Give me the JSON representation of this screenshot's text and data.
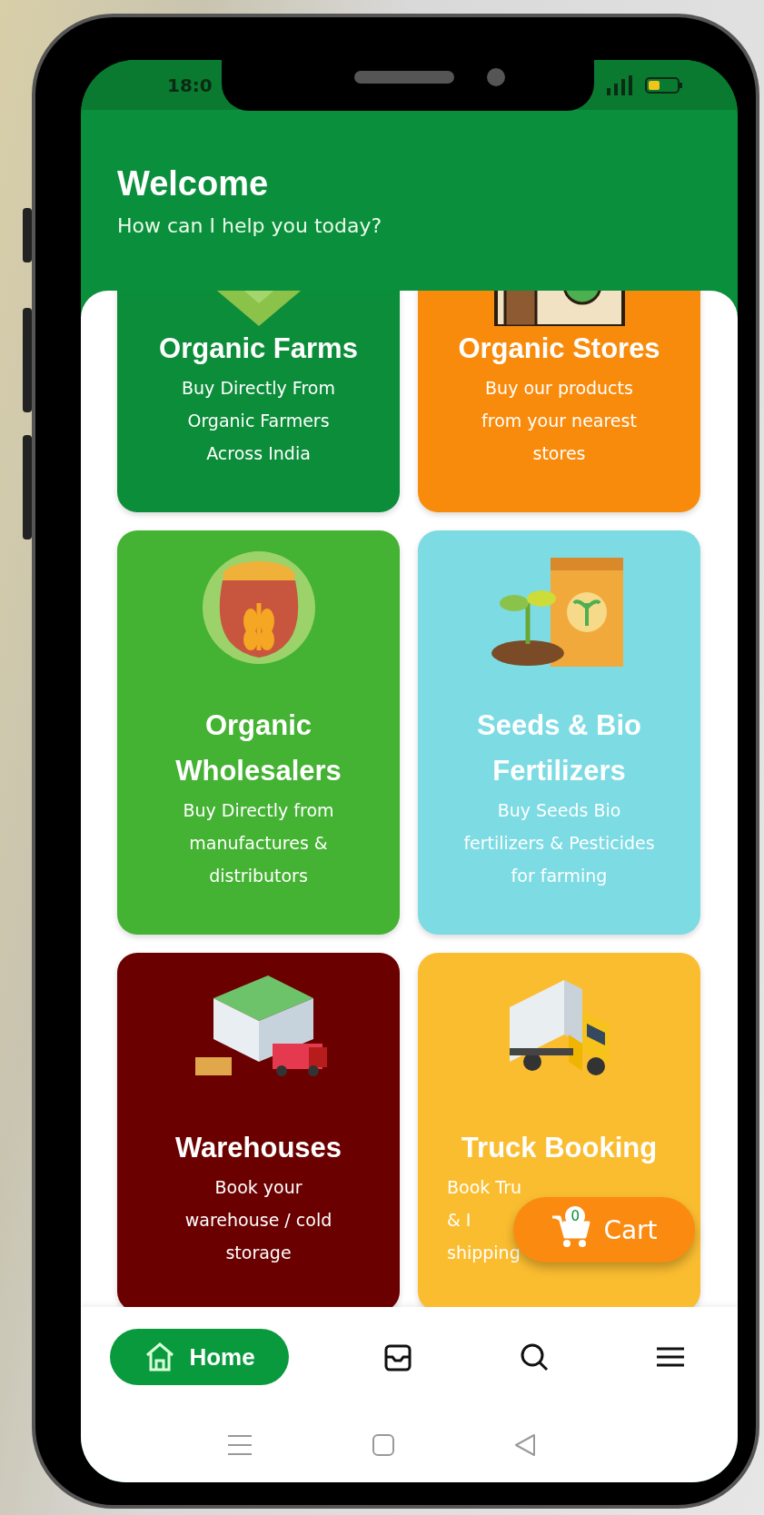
{
  "status_bar": {
    "time": "18:0"
  },
  "header": {
    "title": "Welcome",
    "subtitle": "How can I help you today?"
  },
  "cards": [
    {
      "kind": "farm",
      "color": "#0c8d3a",
      "title": "Organic Farms",
      "description_lines": [
        "Buy Directly From",
        "Organic Farmers",
        "Across India"
      ],
      "partly_covered": false
    },
    {
      "kind": "store",
      "color": "#f98b0c",
      "title": "Organic Stores",
      "description_lines": [
        "Buy our products",
        "from your nearest",
        "stores"
      ],
      "partly_covered": false
    },
    {
      "kind": "pot",
      "color": "#44b232",
      "title": "Organic Wholesalers",
      "description_lines": [
        "Buy Directly from",
        "manufactures &",
        "distributors"
      ],
      "partly_covered": false
    },
    {
      "kind": "seeds",
      "color": "#7cdbe3",
      "title": "Seeds & Bio Fertilizers",
      "description_lines": [
        "Buy Seeds Bio",
        "fertilizers & Pesticides",
        "for farming"
      ],
      "partly_covered": false
    },
    {
      "kind": "warehouse",
      "color": "#6b0000",
      "title": "Warehouses",
      "description_lines": [
        "Book your",
        "warehouse / cold",
        "storage"
      ],
      "partly_covered": false
    },
    {
      "kind": "truck",
      "color": "#fbbd30",
      "title": "Truck Booking",
      "description_lines": [
        "Book Tru",
        "& I",
        "shipping"
      ],
      "partly_covered": true
    }
  ],
  "cart_button": {
    "label": "Cart",
    "count": "0"
  },
  "bottom_nav": [
    {
      "kind": "home",
      "label": "Home",
      "selected": true
    },
    {
      "kind": "inbox",
      "selected": false
    },
    {
      "kind": "search",
      "selected": false
    },
    {
      "kind": "menu",
      "selected": false
    }
  ]
}
